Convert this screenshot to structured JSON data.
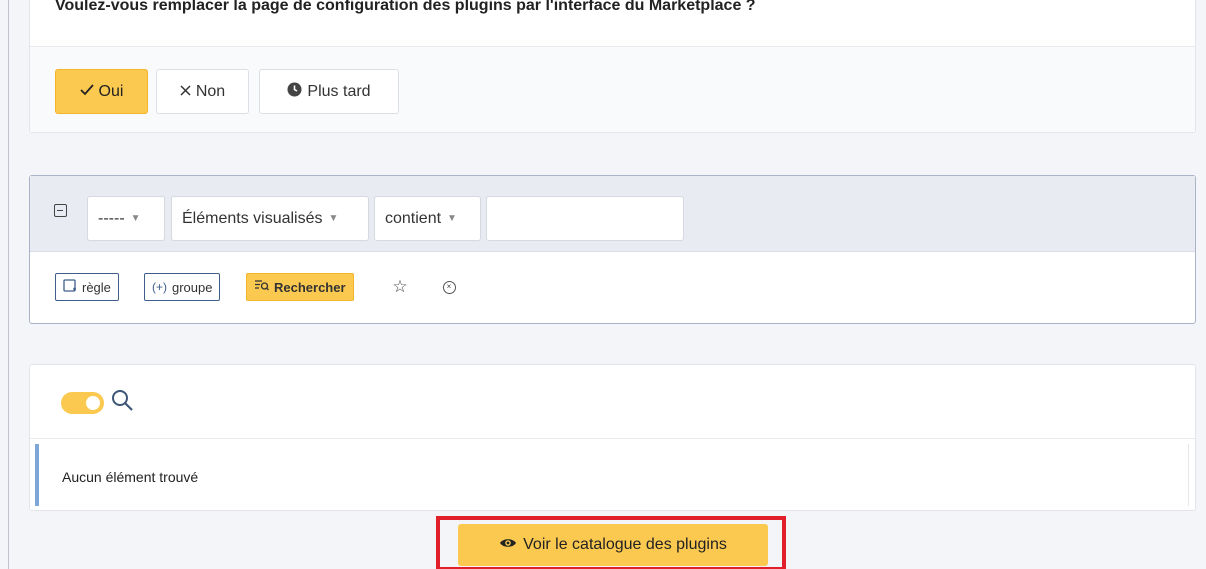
{
  "question": {
    "text": "Voulez-vous remplacer la page de configuration des plugins par l'interface du Marketplace ?",
    "yes_label": "Oui",
    "no_label": "Non",
    "later_label": "Plus tard"
  },
  "search_criteria": {
    "field_1": "-----",
    "field_2": "Éléments visualisés",
    "operator": "contient",
    "value": "",
    "rule_label": "règle",
    "group_label": "groupe",
    "search_label": "Rechercher"
  },
  "results": {
    "empty_message": "Aucun élément trouvé"
  },
  "catalog_button": {
    "label": "Voir le catalogue des plugins"
  },
  "colors": {
    "accent": "#fbc94f",
    "highlight": "#e01f2b",
    "info_border": "#7ea7d8"
  }
}
